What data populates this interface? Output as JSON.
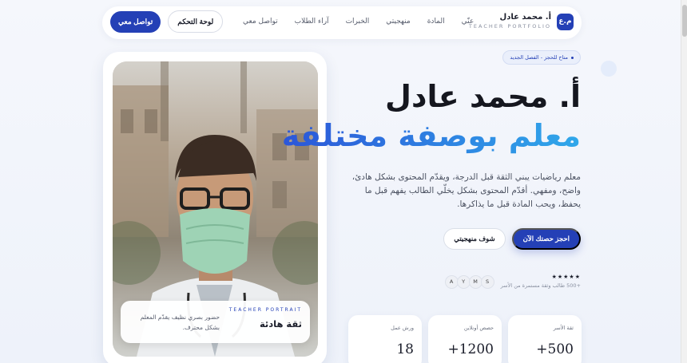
{
  "nav": {
    "brand_name": "أ. محمد عادل",
    "brand_sub": "TEACHER PORTFOLIO",
    "logo_text": "م.ع",
    "links": [
      "عنّي",
      "المادة",
      "منهجيتي",
      "الخبرات",
      "آراء الطلاب",
      "تواصل معي"
    ],
    "dashboard_label": "لوحة التحكم",
    "contact_label": "تواصل معي"
  },
  "hero": {
    "pill": "متاح للحجز - الفصل الجديد",
    "title": "أ. محمد عادل",
    "subtitle": "معلم بوصفة مختلفة",
    "description": "معلم رياضيات يبني الثقة قبل الدرجة، ويقدّم المحتوى بشكل هادئ، واضح، ومفهي. أقدّم المحتوى بشكل يخلّي الطالب يفهم قبل ما يحفظ، ويحب المادة قبل ما يذاكرها.",
    "primary_cta": "احجز حصتك الآن",
    "secondary_cta": "شوف منهجيتي",
    "avatars": [
      "A",
      "Y",
      "M",
      "S"
    ],
    "stars": "★★★★★",
    "social_proof": "+500 طالب وثقة مستمرة من الأسر"
  },
  "photo_caption": {
    "eyebrow": "TEACHER PORTRAIT",
    "title": "ثقة هادئة",
    "text": "حضور بصري نظيف يقدّم المعلم بشكل محترف."
  },
  "stats": [
    {
      "label": "ثقة الأسر",
      "value": "+500"
    },
    {
      "label": "حصص أونلاين",
      "value": "+1200"
    },
    {
      "label": "ورش عمل",
      "value": "18"
    }
  ]
}
